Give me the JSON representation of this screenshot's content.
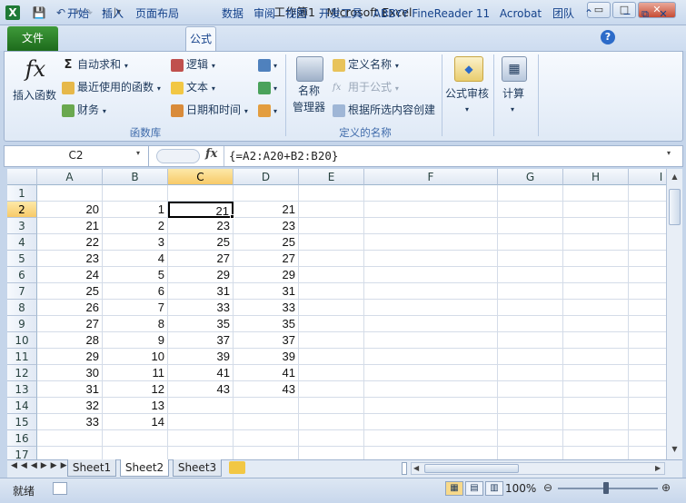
{
  "window": {
    "title": "工作簿1 - Microsoft Excel",
    "minimize_glyph": "▭",
    "maximize_glyph": "□",
    "close_glyph": "✕"
  },
  "qat": {
    "app_icon": "excel-logo-icon",
    "save_icon": "save-icon",
    "undo_icon": "undo-icon",
    "redo_icon": "redo-icon",
    "customize_icon": "dropdown-icon"
  },
  "tabs": [
    "文件",
    "开始",
    "插入",
    "页面布局",
    "公式",
    "数据",
    "审阅",
    "视图",
    "开发工具",
    "ABBYY FineReader 11",
    "Acrobat",
    "团队"
  ],
  "active_tab": "公式",
  "ribbon": {
    "insert_function": "插入函数",
    "autosum": "自动求和",
    "recent": "最近使用的函数",
    "financial": "财务",
    "logical": "逻辑",
    "text": "文本",
    "datetime": "日期和时间",
    "group_library": "函数库",
    "name_manager_line1": "名称",
    "name_manager_line2": "管理器",
    "define_name": "定义名称",
    "use_in_formula": "用于公式",
    "create_from_selection": "根据所选内容创建",
    "group_names": "定义的名称",
    "formula_auditing": "公式审核",
    "calculation": "计算"
  },
  "formula_bar": {
    "name_box": "C2",
    "fx": "fx",
    "formula": "{=A2:A20+B2:B20}"
  },
  "columns": [
    "A",
    "B",
    "C",
    "D",
    "E",
    "F",
    "G",
    "H",
    "I"
  ],
  "selected_column": "C",
  "selected_row": 2,
  "rows": [
    {
      "n": "1",
      "a": "",
      "b": "",
      "c": "",
      "d": ""
    },
    {
      "n": "2",
      "a": "20",
      "b": "1",
      "c": "21",
      "d": "21"
    },
    {
      "n": "3",
      "a": "21",
      "b": "2",
      "c": "23",
      "d": "23"
    },
    {
      "n": "4",
      "a": "22",
      "b": "3",
      "c": "25",
      "d": "25"
    },
    {
      "n": "5",
      "a": "23",
      "b": "4",
      "c": "27",
      "d": "27"
    },
    {
      "n": "6",
      "a": "24",
      "b": "5",
      "c": "29",
      "d": "29"
    },
    {
      "n": "7",
      "a": "25",
      "b": "6",
      "c": "31",
      "d": "31"
    },
    {
      "n": "8",
      "a": "26",
      "b": "7",
      "c": "33",
      "d": "33"
    },
    {
      "n": "9",
      "a": "27",
      "b": "8",
      "c": "35",
      "d": "35"
    },
    {
      "n": "10",
      "a": "28",
      "b": "9",
      "c": "37",
      "d": "37"
    },
    {
      "n": "11",
      "a": "29",
      "b": "10",
      "c": "39",
      "d": "39"
    },
    {
      "n": "12",
      "a": "30",
      "b": "11",
      "c": "41",
      "d": "41"
    },
    {
      "n": "13",
      "a": "31",
      "b": "12",
      "c": "43",
      "d": "43"
    },
    {
      "n": "14",
      "a": "32",
      "b": "13",
      "c": "",
      "d": ""
    },
    {
      "n": "15",
      "a": "33",
      "b": "14",
      "c": "",
      "d": ""
    },
    {
      "n": "16",
      "a": "",
      "b": "",
      "c": "",
      "d": ""
    },
    {
      "n": "17",
      "a": "",
      "b": "",
      "c": "",
      "d": ""
    }
  ],
  "sheets": [
    "Sheet1",
    "Sheet2",
    "Sheet3"
  ],
  "active_sheet": "Sheet2",
  "status": {
    "ready": "就绪",
    "zoom": "100%"
  },
  "colors": {
    "file_tab": "#2a7f27",
    "selected_header": "#f7c968",
    "ribbon_bg": "#dfe9f6"
  }
}
